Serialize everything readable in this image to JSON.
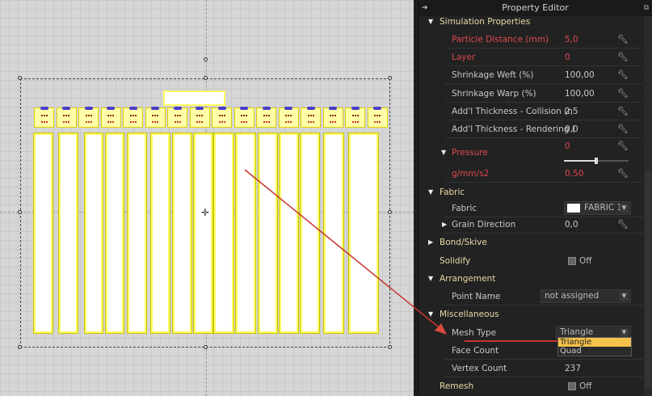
{
  "panel": {
    "title": "Property Editor"
  },
  "simulation": {
    "title": "Simulation Properties",
    "rows": [
      {
        "label": "Particle Distance (mm)",
        "value": "5,0"
      },
      {
        "label": "Layer",
        "value": "0"
      },
      {
        "label": "Shrinkage Weft (%)",
        "value": "100,00"
      },
      {
        "label": "Shrinkage Warp (%)",
        "value": "100,00"
      },
      {
        "label": "Add'l Thickness - Collision (n",
        "value": "2,5"
      },
      {
        "label": "Add'l Thickness - Rendering (",
        "value": "0,0"
      }
    ],
    "pressure": {
      "label": "Pressure",
      "value": "0",
      "slider_fraction": 0.5,
      "unit_label": "g/mm/s2",
      "unit_value": "0.50"
    }
  },
  "fabric": {
    "title": "Fabric",
    "fabric_label": "Fabric",
    "fabric_value": "FABRIC 1",
    "grain_label": "Grain Direction",
    "grain_value": "0,0"
  },
  "bond": {
    "title": "Bond/Skive"
  },
  "solidify": {
    "title": "Solidify",
    "state": "Off"
  },
  "arrangement": {
    "title": "Arrangement",
    "point_label": "Point Name",
    "point_value": "not assigned"
  },
  "misc": {
    "title": "Miscellaneous",
    "mesh_label": "Mesh Type",
    "mesh_value": "Triangle",
    "options": [
      "Triangle",
      "Quad"
    ],
    "face_label": "Face Count",
    "vertex_label": "Vertex Count",
    "vertex_value": "237"
  },
  "remesh": {
    "title": "Remesh",
    "state": "Off"
  },
  "colors": {
    "accent": "#e0484c",
    "highlight": "#f4c14a"
  }
}
